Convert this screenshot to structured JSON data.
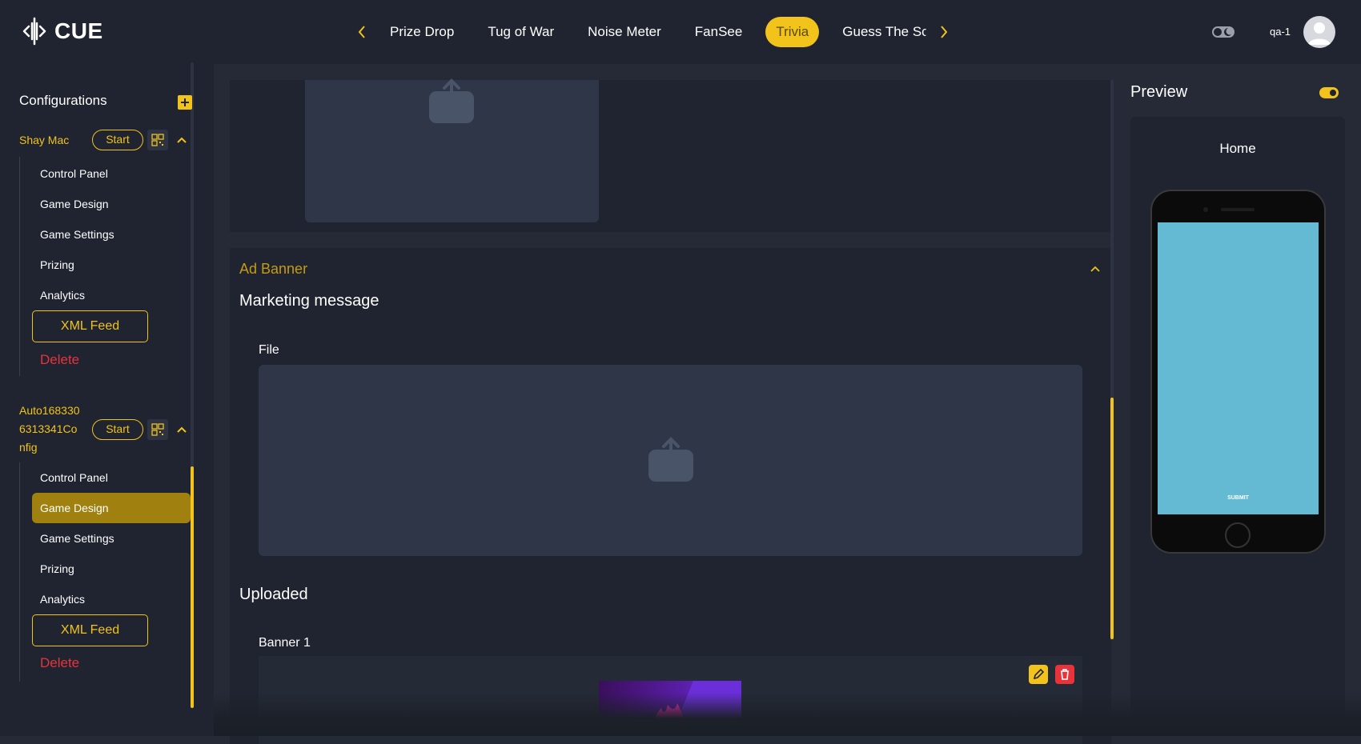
{
  "app": {
    "name": "CUE",
    "user": "qa-1"
  },
  "nav": {
    "tabs": [
      {
        "label": "Prize Drop"
      },
      {
        "label": "Tug of War"
      },
      {
        "label": "Noise Meter"
      },
      {
        "label": "FanSee"
      },
      {
        "label": "Trivia",
        "active": true
      },
      {
        "label": "Guess The Sco"
      }
    ]
  },
  "sidebar": {
    "title": "Configurations",
    "configs": [
      {
        "name": "Shay Mac",
        "start_label": "Start",
        "items": [
          "Control Panel",
          "Game Design",
          "Game Settings",
          "Prizing",
          "Analytics"
        ],
        "xml_label": "XML Feed",
        "delete_label": "Delete"
      },
      {
        "name_lines": [
          "Auto168330",
          "6313341Co",
          "nfig"
        ],
        "start_label": "Start",
        "items": [
          "Control Panel",
          "Game Design",
          "Game Settings",
          "Prizing",
          "Analytics"
        ],
        "active_item": "Game Design",
        "xml_label": "XML Feed",
        "delete_label": "Delete"
      }
    ]
  },
  "main": {
    "ad_banner": {
      "title": "Ad Banner",
      "heading": "Marketing message",
      "file_label": "File",
      "uploaded_heading": "Uploaded",
      "banner_label": "Banner 1"
    }
  },
  "preview": {
    "title": "Preview",
    "screen_name": "Home",
    "submit_label": "SUBMIT"
  },
  "colors": {
    "accent": "#f2c31a",
    "danger": "#e8333b",
    "background": "#252a36",
    "panel": "#1f2430",
    "preview_screen": "#63bad2"
  }
}
